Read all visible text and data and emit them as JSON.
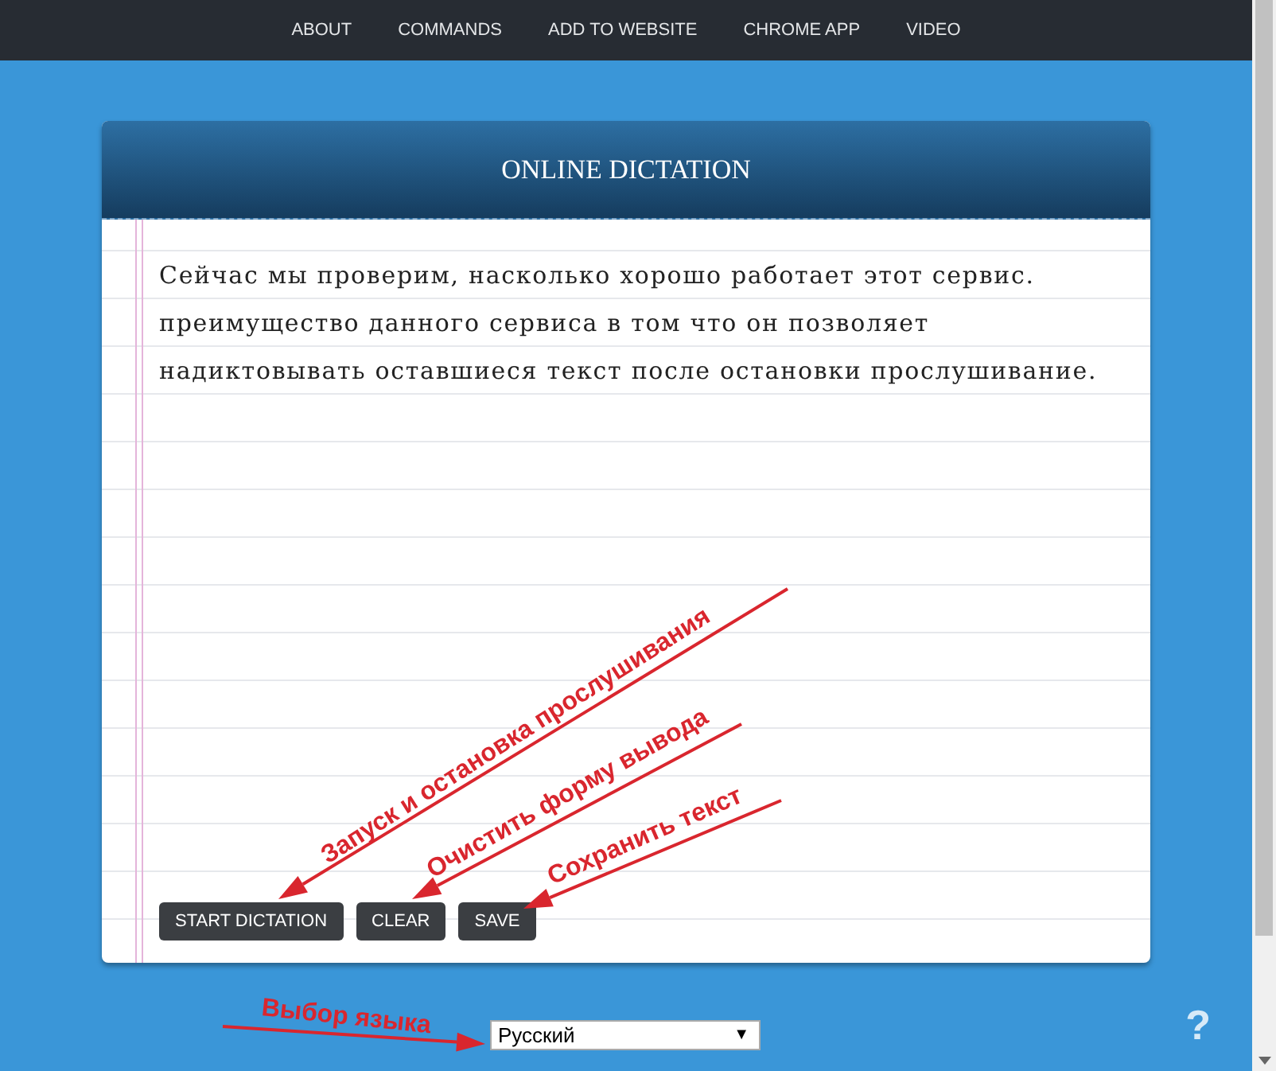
{
  "nav": {
    "items": [
      {
        "label": "ABOUT"
      },
      {
        "label": "COMMANDS"
      },
      {
        "label": "ADD TO WEBSITE"
      },
      {
        "label": "CHROME APP"
      },
      {
        "label": "VIDEO"
      }
    ]
  },
  "card": {
    "title": "ONLINE DICTATION",
    "text": "Сейчас мы проверим, насколько хорошо работает этот сервис. преимущество данного сервиса в том что он позволяет надиктовывать оставшиеся текст после остановки прослушивание.",
    "buttons": [
      {
        "label": "START DICTATION"
      },
      {
        "label": "CLEAR"
      },
      {
        "label": "SAVE"
      }
    ]
  },
  "language_select": {
    "value": "Русский",
    "caret": "▼"
  },
  "help": "?",
  "annotations": [
    {
      "text": "Запуск и остановка прослушивания"
    },
    {
      "text": "Очистить форму вывода"
    },
    {
      "text": "Сохранить текст"
    },
    {
      "text": "Выбор языка"
    }
  ]
}
